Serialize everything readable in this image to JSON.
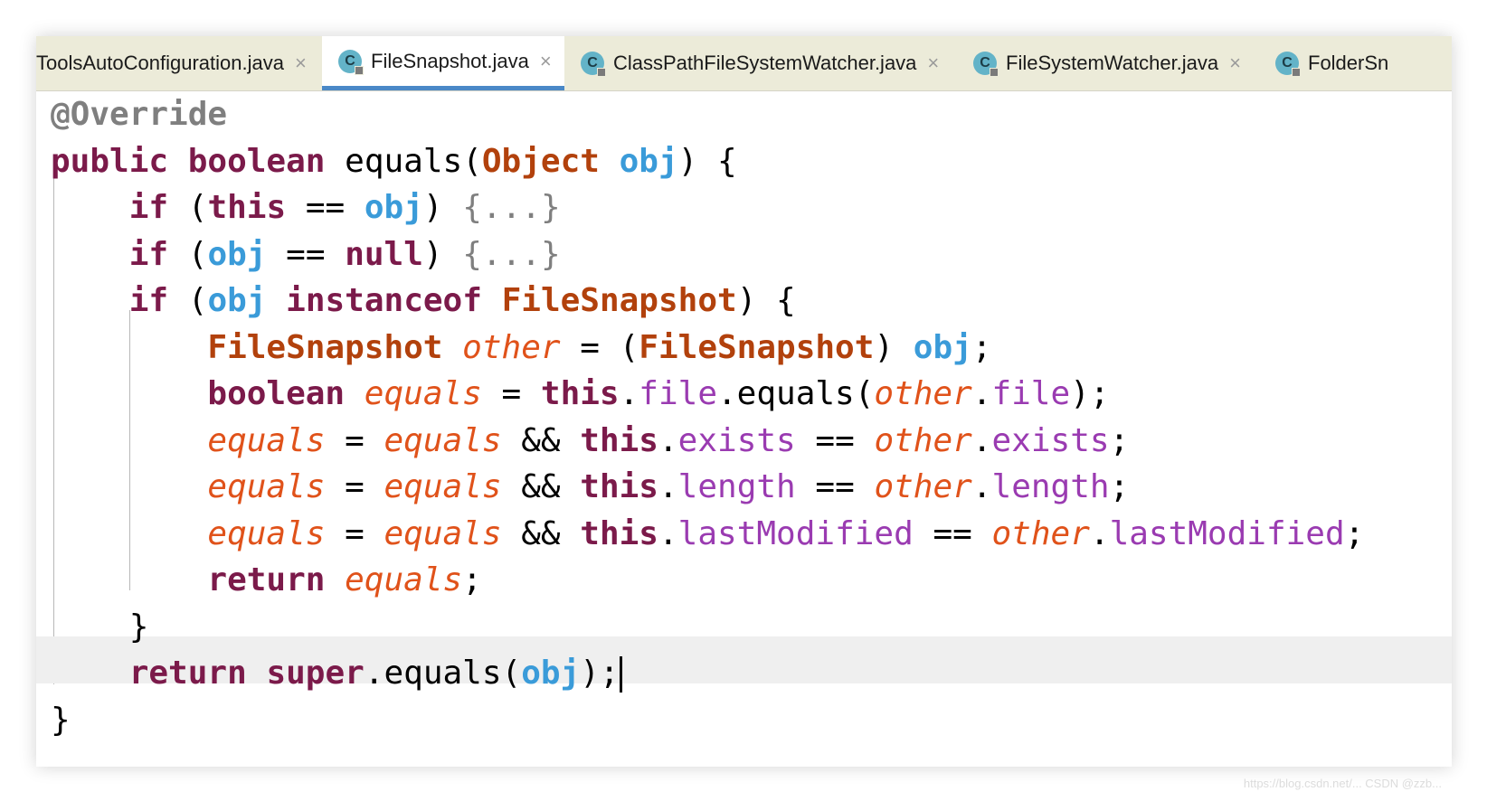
{
  "tabs": [
    {
      "label": "ToolsAutoConfiguration.java",
      "icon": "none",
      "active": false
    },
    {
      "label": "FileSnapshot.java",
      "icon": "class-icon",
      "active": true
    },
    {
      "label": "ClassPathFileSystemWatcher.java",
      "icon": "class-icon",
      "active": false
    },
    {
      "label": "FileSystemWatcher.java",
      "icon": "class-icon",
      "active": false
    },
    {
      "label": "FolderSn",
      "icon": "class-icon",
      "active": false
    }
  ],
  "tab_close_glyph": "×",
  "class_icon_letter": "C",
  "code": {
    "l1": {
      "ann": "@Override"
    },
    "l2": {
      "kw1": "public",
      "kw2": "boolean",
      "m": "equals",
      "p1": "(",
      "typ": "Object",
      "prm": "obj",
      "p2": ") {"
    },
    "l3": {
      "kw": "if",
      "p1": "(",
      "kw2": "this",
      "op": "==",
      "prm": "obj",
      "p2": ")",
      "fold": "{...}"
    },
    "l4": {
      "kw": "if",
      "p1": "(",
      "prm": "obj",
      "op": "==",
      "kw2": "null",
      "p2": ")",
      "fold": "{...}"
    },
    "l5": {
      "kw": "if",
      "p1": "(",
      "prm": "obj",
      "kw2": "instanceof",
      "typ": "FileSnapshot",
      "p2": ") {"
    },
    "l6": {
      "typ": "FileSnapshot",
      "lv": "other",
      "op": "=",
      "p1": "(",
      "typ2": "FileSnapshot",
      "p2": ")",
      "prm": "obj",
      "end": ";"
    },
    "l7": {
      "kw": "boolean",
      "lv": "equals",
      "op": "=",
      "kw2": "this",
      "fld": "file",
      "m": ".equals(",
      "lv2": "other",
      "fld2": "file",
      "end": ");"
    },
    "l8": {
      "lv": "equals",
      "op": "=",
      "lv2": "equals",
      "and": "&&",
      "kw": "this",
      "fld": "exists",
      "eq": "==",
      "lv3": "other",
      "fld2": "exists",
      "end": ";"
    },
    "l9": {
      "lv": "equals",
      "op": "=",
      "lv2": "equals",
      "and": "&&",
      "kw": "this",
      "fld": "length",
      "eq": "==",
      "lv3": "other",
      "fld2": "length",
      "end": ";"
    },
    "l10": {
      "lv": "equals",
      "op": "=",
      "lv2": "equals",
      "and": "&&",
      "kw": "this",
      "fld": "lastModified",
      "eq": "==",
      "lv3": "other",
      "fld2": "lastModified",
      "end": ";"
    },
    "l11": {
      "kw": "return",
      "lv": "equals",
      "end": ";"
    },
    "l12": {
      "brace": "}"
    },
    "l13": {
      "kw": "return",
      "kw2": "super",
      "m": ".equals(",
      "prm": "obj",
      "end": ");"
    },
    "l14": {
      "brace": "}"
    }
  },
  "watermark": "https://blog.csdn.net/... CSDN @zzb..."
}
